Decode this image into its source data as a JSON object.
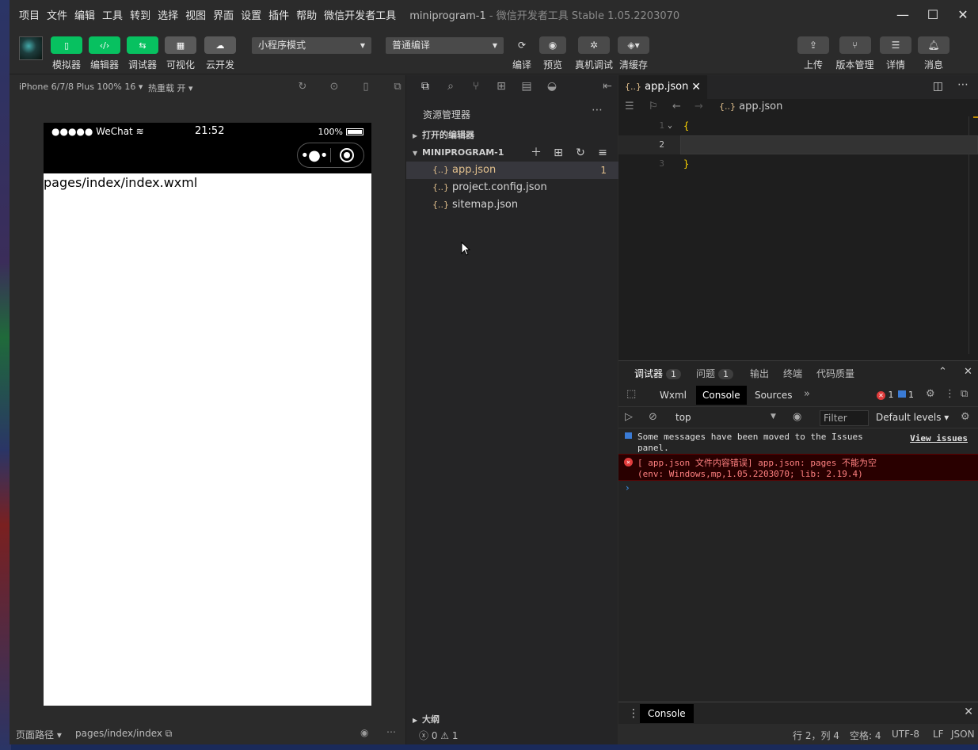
{
  "menu": [
    "项目",
    "文件",
    "编辑",
    "工具",
    "转到",
    "选择",
    "视图",
    "界面",
    "设置",
    "插件",
    "帮助",
    "微信开发者工具"
  ],
  "window_title": {
    "project": "miniprogram-1",
    "app": " - 微信开发者工具 Stable 1.05.2203070"
  },
  "window_controls": {
    "minimize": "—",
    "maximize": "☐",
    "close": "✕"
  },
  "toolbar": {
    "simulator": "模拟器",
    "editor": "编辑器",
    "debugger": "调试器",
    "visual": "可视化",
    "cloud": "云开发",
    "mode_select": "小程序模式",
    "compile_select": "普通编译",
    "compile": "编译",
    "preview": "预览",
    "real_debug": "真机调试",
    "clear_cache": "清缓存",
    "upload": "上传",
    "version": "版本管理",
    "details": "详情",
    "messages": "消息"
  },
  "simulator": {
    "device": "iPhone 6/7/8 Plus 100% 16 ▾",
    "hot_reload": "热重载 开 ▾",
    "carrier": "●●●●● WeChat",
    "time": "21:52",
    "battery": "100%",
    "page_content": "pages/index/index.wxml",
    "footer_label": "页面路径 ▾",
    "footer_path": "pages/index/index"
  },
  "explorer": {
    "title": "资源管理器",
    "open_editors": "打开的编辑器",
    "project": "MINIPROGRAM-1",
    "files": [
      {
        "name": "app.json",
        "badge": "1"
      },
      {
        "name": "project.config.json",
        "badge": ""
      },
      {
        "name": "sitemap.json",
        "badge": ""
      }
    ],
    "outline": "大纲",
    "problems": "ⓧ 0 ⚠ 1"
  },
  "editor": {
    "tab": "app.json",
    "breadcrumb": "app.json",
    "lines": [
      {
        "num": "1",
        "text": "{"
      },
      {
        "num": "2",
        "text": ""
      },
      {
        "num": "3",
        "text": "}"
      }
    ]
  },
  "devtools": {
    "tabs": [
      {
        "label": "调试器",
        "count": "1"
      },
      {
        "label": "问题",
        "count": "1"
      },
      {
        "label": "输出",
        "count": ""
      },
      {
        "label": "终端",
        "count": ""
      },
      {
        "label": "代码质量",
        "count": ""
      }
    ],
    "subtabs": {
      "wxml": "Wxml",
      "console": "Console",
      "sources": "Sources"
    },
    "err_count": "1",
    "info_count": "1",
    "context": "top",
    "filter_placeholder": "Filter",
    "levels": "Default levels ▾",
    "info_msg": "Some messages have been moved to the Issues panel.",
    "info_link": "View issues",
    "err_line1": "[ app.json 文件内容错误] app.json: pages 不能为空",
    "err_line2": "(env: Windows,mp,1.05.2203070; lib: 2.19.4)",
    "drawer_tab": "Console"
  },
  "statusbar": {
    "position": "行 2，列 4",
    "spaces": "空格: 4",
    "encoding": "UTF-8",
    "eol": "LF",
    "language": "JSON"
  }
}
